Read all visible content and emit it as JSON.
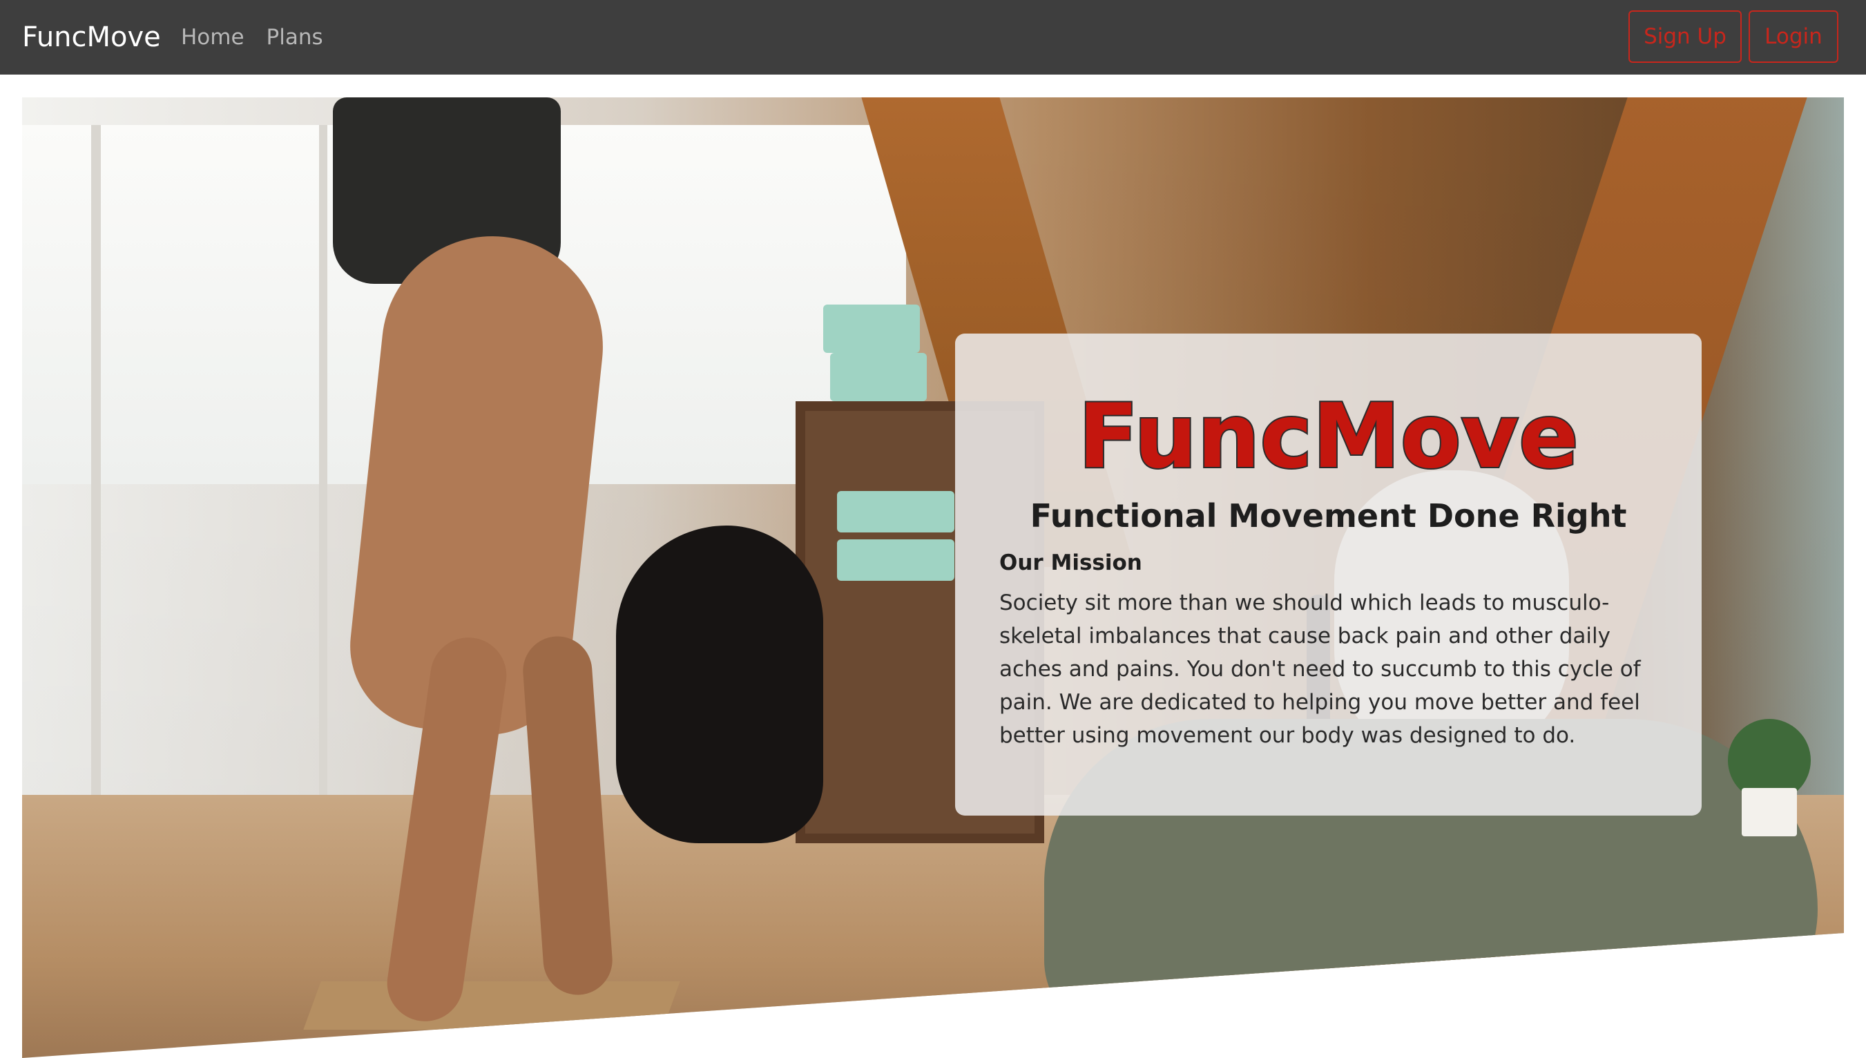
{
  "navbar": {
    "brand": "FuncMove",
    "links": [
      {
        "label": "Home"
      },
      {
        "label": "Plans"
      }
    ],
    "signup_label": "Sign Up",
    "login_label": "Login"
  },
  "hero": {
    "card": {
      "title": "FuncMove",
      "subtitle": "Functional Movement Done Right",
      "heading": "Our Mission",
      "body": "Society sit more than we should which leads to musculo-skeletal imbalances that cause back pain and other daily aches and pains. You don't need to succumb to this cycle of pain. We are dedicated to helping you move better and feel better using movement our body was designed to do."
    }
  },
  "colors": {
    "navbar_bg": "#3e3e3e",
    "accent_red": "#c8261c",
    "title_red": "#c4160e"
  }
}
